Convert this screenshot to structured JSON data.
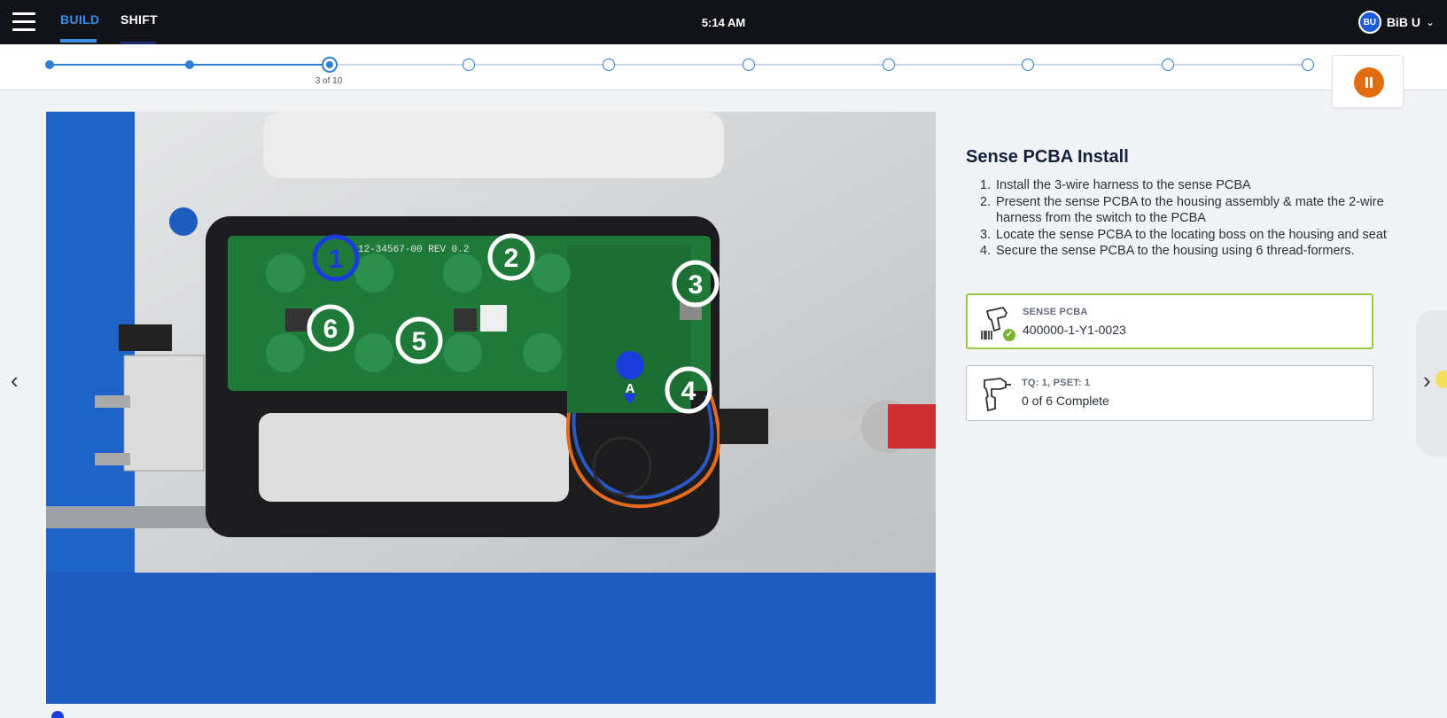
{
  "header": {
    "tabs": [
      {
        "label": "BUILD",
        "active": true
      },
      {
        "label": "SHIFT",
        "active": false
      }
    ],
    "time": "5:14 AM",
    "user": {
      "initials": "BU",
      "name": "BiB U"
    }
  },
  "progress": {
    "current_step": 3,
    "total_steps": 10,
    "label": "3 of 10"
  },
  "image": {
    "pcb_text": "12-34567-00 REV 0.2",
    "callouts": [
      "1",
      "2",
      "3",
      "4",
      "5",
      "6"
    ],
    "marker": "A"
  },
  "instruction": {
    "title": "Sense PCBA Install",
    "steps": [
      "Install the 3-wire harness to the sense PCBA",
      "Present the sense PCBA to the housing assembly & mate the 2-wire harness from the switch to the PCBA",
      "Locate the sense PCBA to the locating boss on the housing and seat",
      "Secure the sense PCBA to the housing using 6 thread-formers."
    ]
  },
  "cards": {
    "scan": {
      "label": "SENSE PCBA",
      "value": "400000-1-Y1-0023",
      "status": "complete",
      "icon": "barcode-scanner-icon"
    },
    "torque": {
      "label": "TQ: 1, PSET: 1",
      "value": "0 of 6 Complete",
      "icon": "torque-driver-icon"
    }
  },
  "colors": {
    "accent": "#2d7fd3",
    "topbar": "#111319",
    "pause": "#e06d10",
    "success": "#9ac846",
    "active_callout": "#1a3cdb"
  }
}
